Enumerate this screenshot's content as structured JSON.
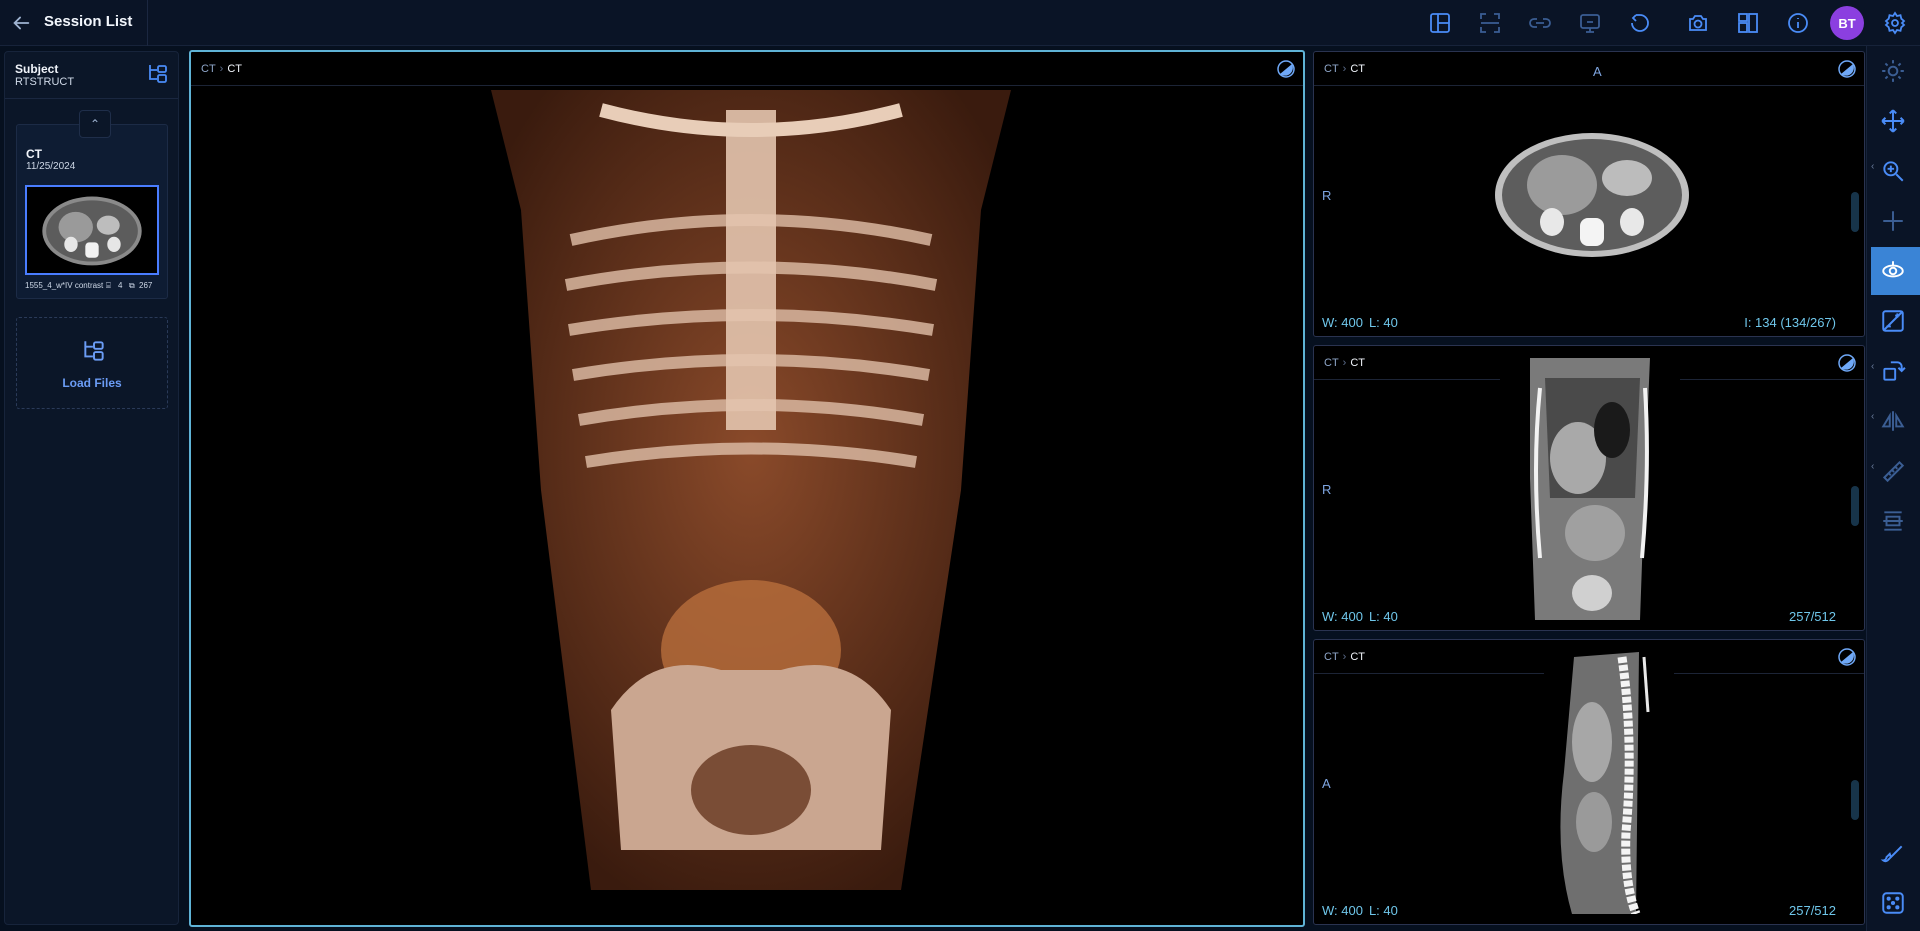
{
  "header": {
    "title": "Session List",
    "avatar_initials": "BT"
  },
  "toolbar_icons": [
    "layout-icon",
    "crop-icon",
    "link-icon",
    "presentation-icon",
    "reset-icon",
    "camera-icon",
    "panels-icon",
    "info-icon",
    "settings-icon"
  ],
  "subject": {
    "label": "Subject",
    "value": "RTSTRUCT"
  },
  "series": {
    "modality": "CT",
    "date": "11/25/2024",
    "description": "1555_4_w*IV contrast",
    "instances_a": "4",
    "instances_b": "267"
  },
  "load_files": {
    "label": "Load Files"
  },
  "viewports": {
    "main": {
      "crumb1": "CT",
      "crumb2": "CT"
    },
    "axial": {
      "crumb1": "CT",
      "crumb2": "CT",
      "orient_top": "A",
      "orient_left": "R",
      "w": "W: 400",
      "l": "L: 40",
      "slice": "I: 134 (134/267)"
    },
    "coronal": {
      "crumb1": "CT",
      "crumb2": "CT",
      "orient_left": "R",
      "w": "W: 400",
      "l": "L: 40",
      "slice": "257/512"
    },
    "sagittal": {
      "crumb1": "CT",
      "crumb2": "CT",
      "orient_left": "A",
      "w": "W: 400",
      "l": "L: 40",
      "slice": "257/512"
    }
  },
  "colors": {
    "accent": "#4a7dff",
    "active_border": "#5fb3d6",
    "overlay_text": "#6fc6ea",
    "avatar": "#8b3fe0",
    "active_tool": "#3a84d6"
  }
}
